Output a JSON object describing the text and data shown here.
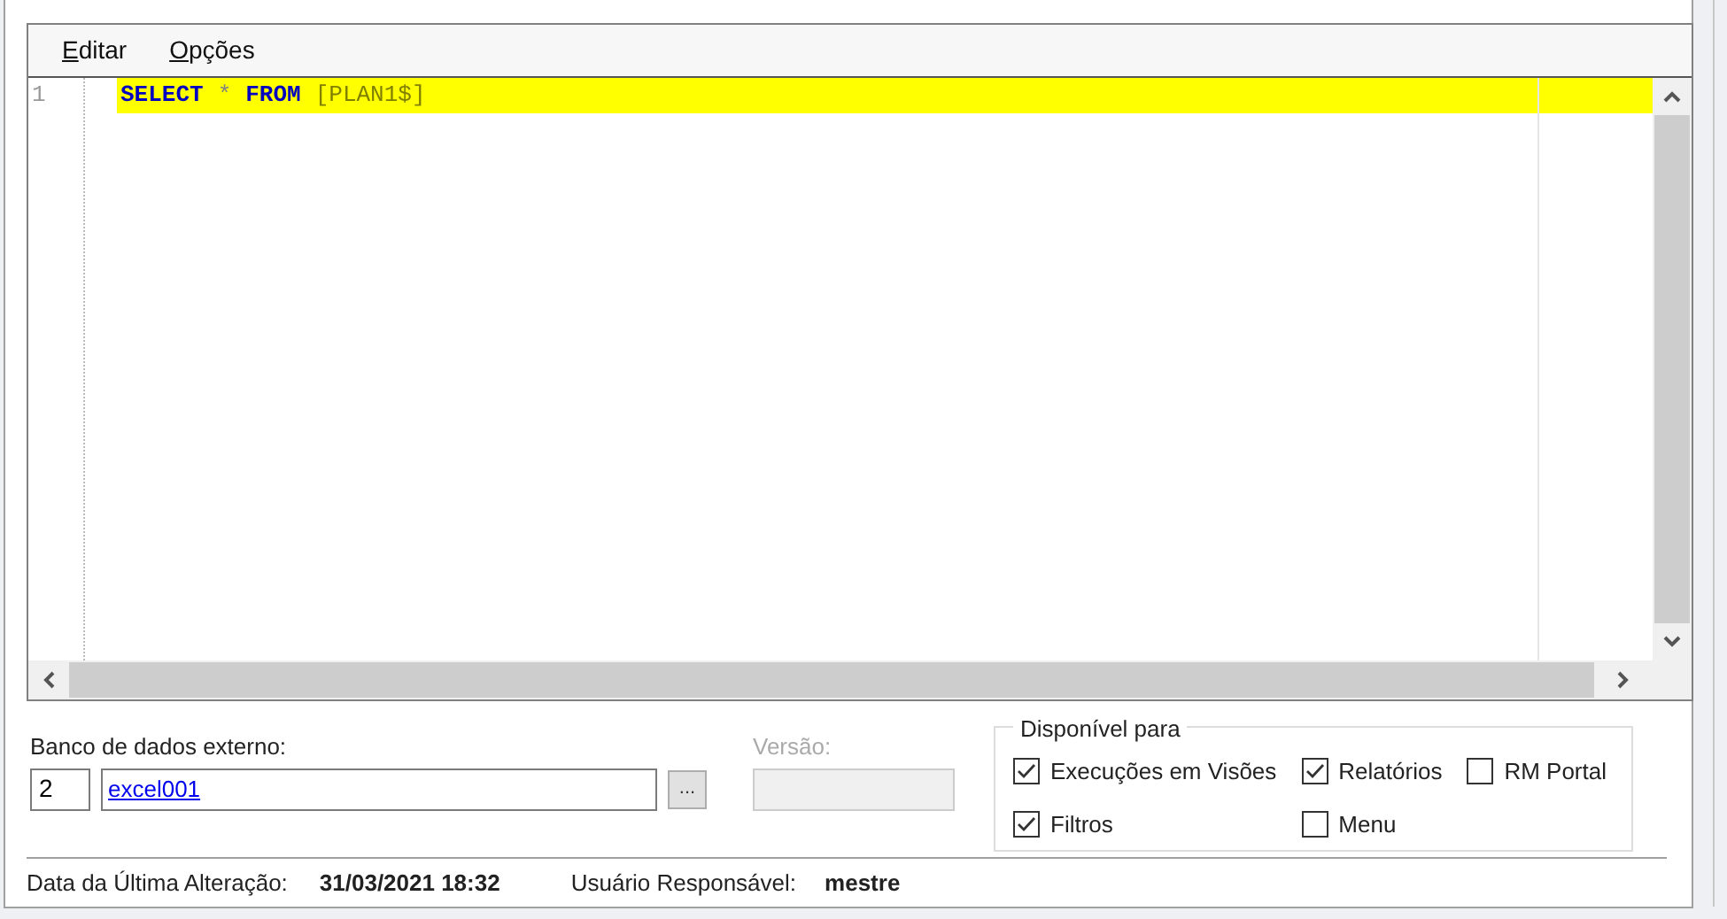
{
  "menu": [
    {
      "label": "Editar"
    },
    {
      "label": "Opções"
    }
  ],
  "editor": {
    "lines": [
      {
        "number": "1",
        "highlighted": true,
        "tokens": [
          {
            "kind": "keyword",
            "text": "SELECT"
          },
          {
            "kind": "operator",
            "text": "*"
          },
          {
            "kind": "keyword",
            "text": "FROM"
          },
          {
            "kind": "identifier",
            "text": "[PLAN1$]"
          }
        ]
      }
    ]
  },
  "external_db": {
    "label": "Banco de dados externo:",
    "code": "2",
    "name": "excel001",
    "browse": "..."
  },
  "version": {
    "label": "Versão:",
    "disabled": true
  },
  "available_for": {
    "title": "Disponível para",
    "options": [
      {
        "label": "Execuções em Visões",
        "checked": true
      },
      {
        "label": "Relatórios",
        "checked": true
      },
      {
        "label": "RM Portal",
        "checked": false
      },
      {
        "label": "Filtros",
        "checked": true
      },
      {
        "label": "Menu",
        "checked": false
      }
    ]
  },
  "status": {
    "date_label": "Data da Última Alteração:",
    "date": "31/03/2021 18:32",
    "user_label": "Usuário Responsável:",
    "user": "mestre"
  }
}
